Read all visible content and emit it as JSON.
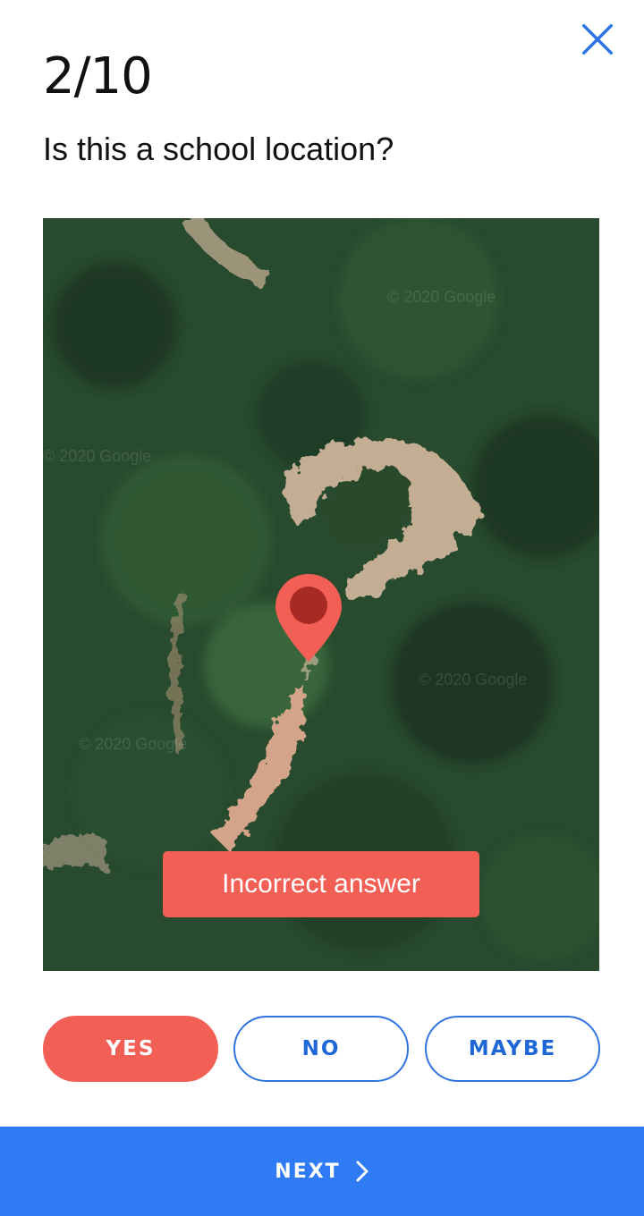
{
  "header": {
    "progress": "2/10",
    "close_icon": "close-icon"
  },
  "question": {
    "text": "Is this a school location?"
  },
  "map": {
    "marker_icon": "location-pin-icon",
    "watermark": "© 2020 Google"
  },
  "feedback": {
    "text": "Incorrect answer",
    "color": "#f25f55"
  },
  "answers": [
    {
      "label": "YES",
      "selected": true
    },
    {
      "label": "NO",
      "selected": false
    },
    {
      "label": "MAYBE",
      "selected": false
    }
  ],
  "footer": {
    "next_label": "NEXT",
    "next_icon": "chevron-right-icon"
  },
  "colors": {
    "accent": "#2f7bf5",
    "alert": "#f25f55",
    "text": "#111111"
  }
}
